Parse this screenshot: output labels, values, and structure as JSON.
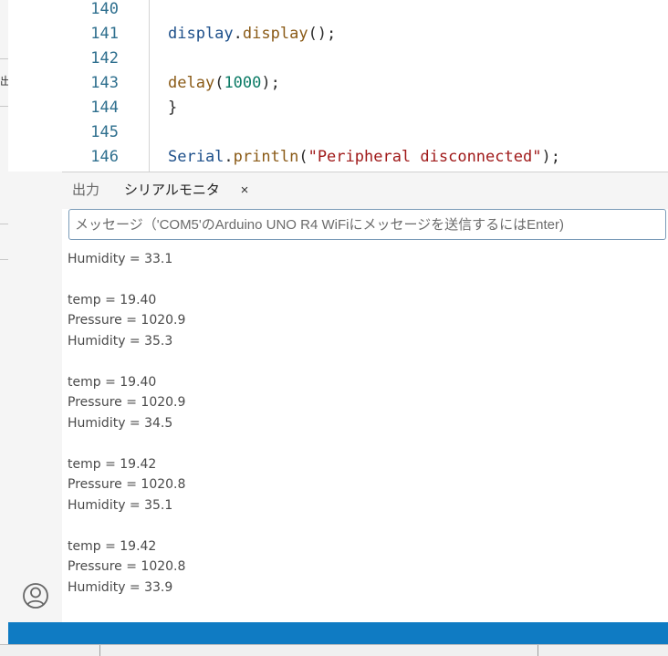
{
  "background_window": {
    "left_label": "出",
    "bottom_ticks": 2
  },
  "editor": {
    "lines": [
      {
        "number": "140",
        "tokens": []
      },
      {
        "number": "141",
        "tokens": [
          {
            "t": "display",
            "k": "obj"
          },
          {
            "t": ".",
            "k": "punc"
          },
          {
            "t": "display",
            "k": "fn"
          },
          {
            "t": "();",
            "k": "punc"
          }
        ]
      },
      {
        "number": "142",
        "tokens": []
      },
      {
        "number": "143",
        "tokens": [
          {
            "t": "delay",
            "k": "fn"
          },
          {
            "t": "(",
            "k": "punc"
          },
          {
            "t": "1000",
            "k": "num"
          },
          {
            "t": ");",
            "k": "punc"
          }
        ]
      },
      {
        "number": "144",
        "tokens": [
          {
            "t": "}",
            "k": "punc"
          }
        ]
      },
      {
        "number": "145",
        "tokens": []
      },
      {
        "number": "146",
        "tokens": [
          {
            "t": "Serial",
            "k": "obj"
          },
          {
            "t": ".",
            "k": "punc"
          },
          {
            "t": "println",
            "k": "fn"
          },
          {
            "t": "(",
            "k": "punc"
          },
          {
            "t": "\"Peripheral disconnected\"",
            "k": "str"
          },
          {
            "t": ");",
            "k": "punc"
          }
        ]
      }
    ]
  },
  "panel": {
    "tabs": {
      "output": "出力",
      "serial_monitor": "シリアルモニタ",
      "close": "×"
    },
    "message_input": {
      "placeholder": "メッセージ（'COM5'のArduino UNO R4 WiFiにメッセージを送信するにはEnter)",
      "value": ""
    },
    "output_lines": [
      "Pressure = 1020.9",
      "Humidity = 33.1",
      "",
      "temp = 19.40",
      "Pressure = 1020.9",
      "Humidity = 35.3",
      "",
      "temp = 19.40",
      "Pressure = 1020.9",
      "Humidity = 34.5",
      "",
      "temp = 19.42",
      "Pressure = 1020.8",
      "Humidity = 35.1",
      "",
      "temp = 19.42",
      "Pressure = 1020.8",
      "Humidity = 33.9"
    ]
  },
  "sidebar": {
    "account_icon": "account-icon"
  },
  "colors": {
    "status_bar": "#0f7bc3",
    "line_number": "#2e6f8e",
    "object": "#1d4f8a",
    "function": "#8a5a16",
    "number": "#0c7b66",
    "string": "#a01a1a"
  }
}
